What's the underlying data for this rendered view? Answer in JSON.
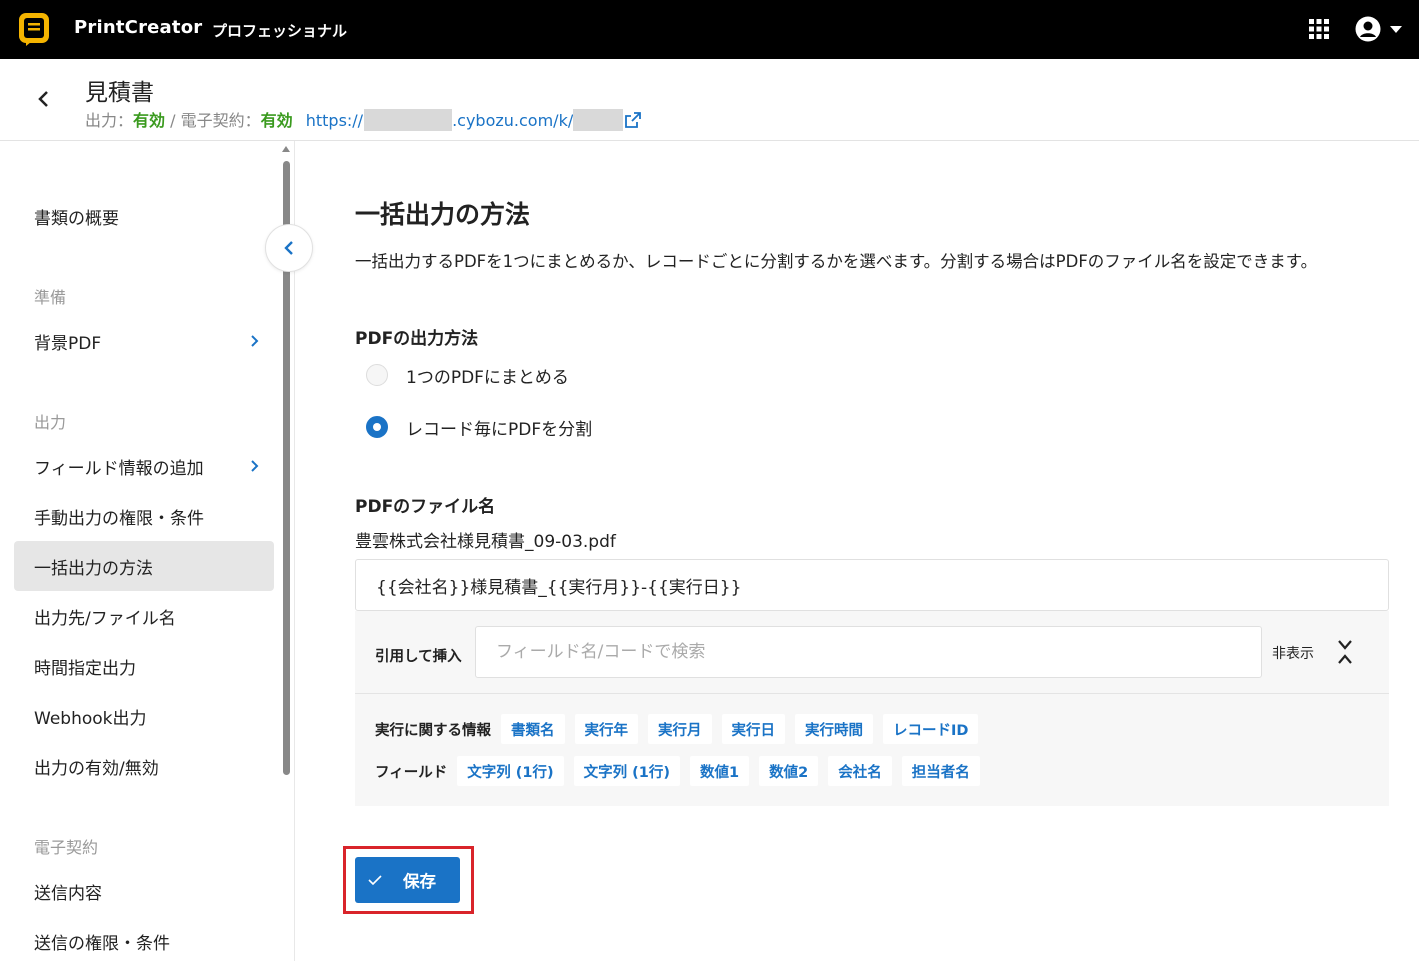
{
  "app": {
    "name": "PrintCreator",
    "edition": "プロフェッショナル",
    "accent_color": "#1a73c6",
    "icons": {
      "logo": "printcreator-logo",
      "apps": "grid-icon",
      "account": "user-circle-icon",
      "account_menu": "caret-down-icon"
    }
  },
  "header": {
    "title": "見積書",
    "output_label": "出力：",
    "output_value": "有効",
    "separator": " / ",
    "contract_label": "電子契約：",
    "contract_value": "有効",
    "url_prefix": "https://",
    "url_mid": ".cybozu.com/k/",
    "status_color": "#3a9a1e"
  },
  "sidebar": {
    "items_top": [
      {
        "label": "書類の概要"
      }
    ],
    "section_prepare": "準備",
    "items_prepare": [
      {
        "label": "背景PDF",
        "has_chevron": true
      }
    ],
    "section_output": "出力",
    "items_output": [
      {
        "label": "フィールド情報の追加",
        "has_chevron": true
      },
      {
        "label": "手動出力の権限・条件"
      },
      {
        "label": "一括出力の方法",
        "active": true
      },
      {
        "label": "出力先/ファイル名"
      },
      {
        "label": "時間指定出力"
      },
      {
        "label": "Webhook出力"
      },
      {
        "label": "出力の有効/無効"
      }
    ],
    "section_contract": "電子契約",
    "items_contract": [
      {
        "label": "送信内容"
      },
      {
        "label": "送信の権限・条件"
      }
    ]
  },
  "main": {
    "title": "一括出力の方法",
    "description": "一括出力するPDFを1つにまとめるか、レコードごとに分割するかを選べます。分割する場合はPDFのファイル名を設定できます。",
    "pdf_output": {
      "label": "PDFの出力方法",
      "options": [
        {
          "label": "1つのPDFにまとめる",
          "checked": false
        },
        {
          "label": "レコード毎にPDFを分割",
          "checked": true
        }
      ]
    },
    "filename": {
      "label": "PDFのファイル名",
      "preview": "豊雲株式会社様見積書_09-03.pdf",
      "value": "{{会社名}}様見積書_{{実行月}}-{{実行日}}"
    },
    "insert": {
      "label": "引用して挿入",
      "placeholder": "フィールド名/コードで検索",
      "hide_label": "非表示",
      "exec_label": "実行に関する情報",
      "exec_chips": [
        "書類名",
        "実行年",
        "実行月",
        "実行日",
        "実行時間",
        "レコードID"
      ],
      "field_label": "フィールド",
      "field_chips": [
        "文字列 (1行)",
        "文字列 (1行)",
        "数値1",
        "数値2",
        "会社名",
        "担当者名"
      ]
    },
    "save_label": "保存",
    "highlight_color": "#d9242a"
  }
}
